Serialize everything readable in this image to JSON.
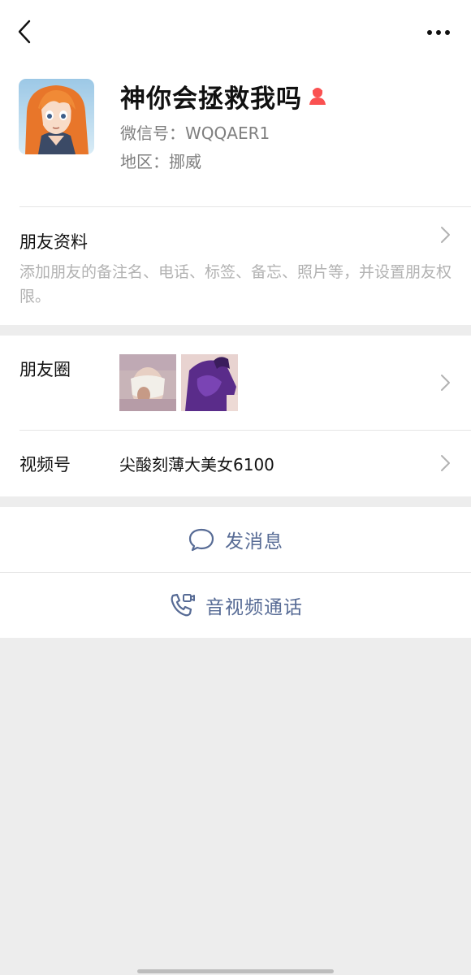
{
  "profile": {
    "name": "神你会拯救我吗",
    "wechat_id": "微信号：WQQAER1",
    "region": "地区：挪威",
    "gender_icon": "female-person-icon",
    "gender_color": "#fa5151"
  },
  "friend_info": {
    "title": "朋友资料",
    "description": "添加朋友的备注名、电话、标签、备忘、照片等，并设置朋友权限。"
  },
  "moments": {
    "title": "朋友圈"
  },
  "channels": {
    "title": "视频号",
    "value": "尖酸刻薄大美女6100"
  },
  "actions": {
    "message": "发消息",
    "call": "音视频通话"
  },
  "colors": {
    "link": "#576b95",
    "background": "#ededed",
    "card": "#ffffff"
  }
}
